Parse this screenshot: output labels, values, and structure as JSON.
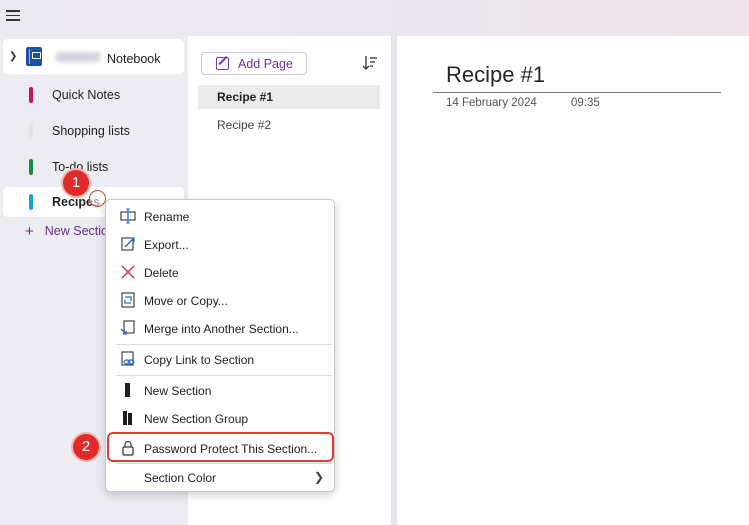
{
  "notebook": {
    "name": "Notebook",
    "color": "#1e4fa3"
  },
  "sections": [
    {
      "label": "Quick Notes",
      "color": "#c2185b"
    },
    {
      "label": "Shopping lists",
      "color": "#e4e4e8"
    },
    {
      "label": "To-do lists",
      "color": "#1b8a3c"
    },
    {
      "label": "Recipes",
      "color": "#1aa3d9",
      "active": true
    }
  ],
  "new_section_label": "New Section",
  "pages_panel": {
    "add_page_label": "Add Page",
    "pages": [
      {
        "label": "Recipe #1",
        "active": true
      },
      {
        "label": "Recipe #2"
      }
    ]
  },
  "page": {
    "title": "Recipe #1",
    "date": "14 February 2024",
    "time": "09:35"
  },
  "context_menu": {
    "items": [
      {
        "label": "Rename",
        "icon": "rename-icon"
      },
      {
        "label": "Export...",
        "icon": "export-icon"
      },
      {
        "label": "Delete",
        "icon": "delete-icon"
      },
      {
        "label": "Move or Copy...",
        "icon": "move-copy-icon"
      },
      {
        "label": "Merge into Another Section...",
        "icon": "merge-icon"
      },
      {
        "label": "Copy Link to Section",
        "icon": "copy-link-icon"
      },
      {
        "label": "New Section",
        "icon": "new-section-icon"
      },
      {
        "label": "New Section Group",
        "icon": "new-section-group-icon"
      },
      {
        "label": "Password Protect This Section...",
        "icon": "lock-icon"
      },
      {
        "label": "Section Color",
        "icon": "",
        "has_submenu": true
      }
    ]
  },
  "callouts": [
    "1",
    "2"
  ],
  "colors": {
    "accent": "#6b2fa0",
    "highlight": "#e53935",
    "delete": "#d13438"
  }
}
